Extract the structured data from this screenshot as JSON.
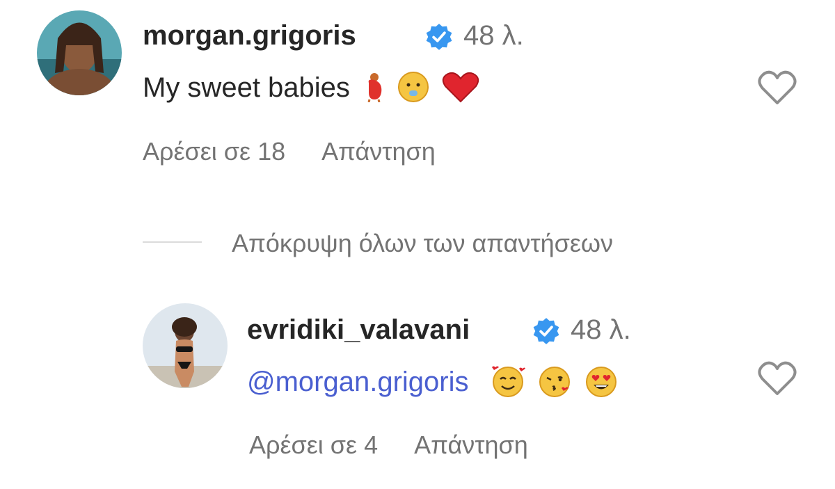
{
  "comments": [
    {
      "username": "morgan.grigoris",
      "time": "48 λ.",
      "text": "My sweet babies",
      "likes_label": "Αρέσει σε 18",
      "reply_label": "Απάντηση"
    },
    {
      "username": "evridiki_valavani",
      "time": "48 λ.",
      "mention": "@morgan.grigoris",
      "likes_label": "Αρέσει σε 4",
      "reply_label": "Απάντηση"
    }
  ],
  "replies_toggle": {
    "label": "Απόκρυψη όλων των απαντήσεων"
  },
  "colors": {
    "verified": "#3897f0",
    "mention": "#4a5fd0",
    "secondary_text": "#737373",
    "heart_outline": "#8e8e8e"
  },
  "icons": [
    "verified-badge-icon",
    "heart-outline-icon"
  ]
}
